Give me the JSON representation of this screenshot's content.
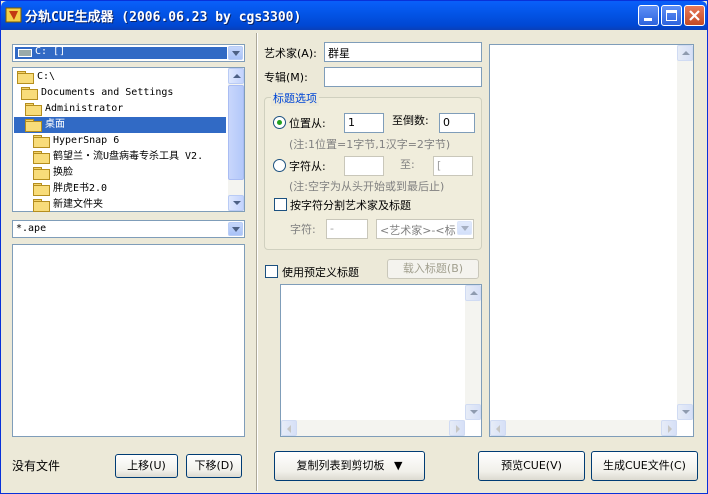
{
  "window": {
    "title": "分轨CUE生成器 (2006.06.23 by cgs3300)",
    "colors": {
      "title_bar": "#0054e3",
      "face": "#ece9d8",
      "selection": "#316ac5",
      "groupbox_title": "#0046d5",
      "close_button": "#d4542c"
    }
  },
  "left": {
    "drive_select": {
      "value": "C: []"
    },
    "tree": [
      {
        "label": "C:\\",
        "icon": "open-folder-icon"
      },
      {
        "label": "Documents and Settings",
        "icon": "open-folder-icon"
      },
      {
        "label": "Administrator",
        "icon": "open-folder-icon"
      },
      {
        "label": "桌面",
        "icon": "open-folder-icon",
        "selected": true
      },
      {
        "label": "HyperSnap 6",
        "icon": "folder-icon"
      },
      {
        "label": "鹤望兰・流U盘病毒专杀工具 V2.",
        "icon": "folder-icon"
      },
      {
        "label": "换脸",
        "icon": "folder-icon"
      },
      {
        "label": "胖虎E书2.0",
        "icon": "folder-icon"
      },
      {
        "label": "新建文件夹",
        "icon": "folder-icon"
      }
    ],
    "filter_select": {
      "value": "*.ape"
    },
    "status": "没有文件",
    "move_up_label": "上移(U)",
    "move_down_label": "下移(D)"
  },
  "middle": {
    "artist_label": "艺术家(A):",
    "artist_value": "群星",
    "album_label": "专辑(M):",
    "album_value": "",
    "title_options": {
      "legend": "标题选项",
      "position_label": "位置从:",
      "position_value": "1",
      "reverse_label": "至倒数:",
      "reverse_value": "0",
      "position_note": "(注:1位置=1字节,1汉字=2字节)",
      "char_label": "字符从:",
      "char_from_value": "",
      "char_to_label": "至:",
      "char_to_value": "[",
      "char_note": "(注:空字为从头开始或到最后止)",
      "split_label": "按字符分割艺术家及标题",
      "char_field_label": "字符:",
      "char_field_value": "-",
      "order_select": "<艺术家>-<标"
    },
    "predefined_label": "使用预定义标题",
    "load_title_label": "载入标题(B)",
    "copy_button_label": "复制列表到剪切板",
    "copy_button_arrow": "▼"
  },
  "right": {
    "preview_label": "预览CUE(V)",
    "generate_label": "生成CUE文件(C)"
  }
}
